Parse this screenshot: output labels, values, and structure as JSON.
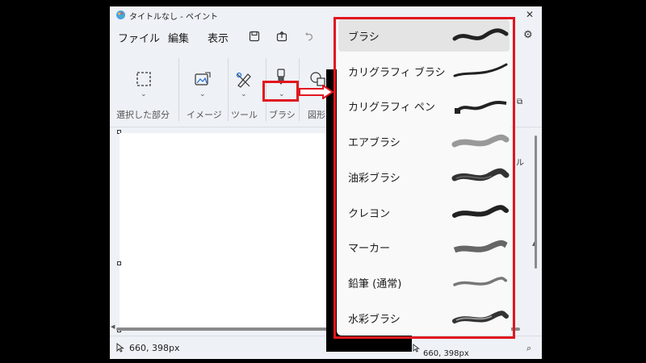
{
  "window": {
    "title": "タイトルなし - ペイント"
  },
  "menu": {
    "file": "ファイル",
    "edit": "編集",
    "view": "表示"
  },
  "ribbon": {
    "selection_label": "選択した部分",
    "image_label": "イメージ",
    "tools_label": "ツール",
    "brushes_label": "ブラシ",
    "shapes_label": "図形"
  },
  "status": {
    "cursor_position": "660, 398px",
    "cursor_position_partial": "660, 398px"
  },
  "brush_menu": {
    "items": [
      {
        "label": "ブラシ",
        "selected": true,
        "stroke": "solid"
      },
      {
        "label": "カリグラフィ ブラシ",
        "selected": false,
        "stroke": "calligraphy"
      },
      {
        "label": "カリグラフィ ペン",
        "selected": false,
        "stroke": "calligraphy-pen"
      },
      {
        "label": "エアブラシ",
        "selected": false,
        "stroke": "airbrush"
      },
      {
        "label": "油彩ブラシ",
        "selected": false,
        "stroke": "oil"
      },
      {
        "label": "クレヨン",
        "selected": false,
        "stroke": "crayon"
      },
      {
        "label": "マーカー",
        "selected": false,
        "stroke": "marker"
      },
      {
        "label": "鉛筆 (通常)",
        "selected": false,
        "stroke": "pencil"
      },
      {
        "label": "水彩ブラシ",
        "selected": false,
        "stroke": "watercolor"
      }
    ]
  },
  "colors": {
    "annotation_red": "#e1161f",
    "accent_blue": "#1f6fd6"
  }
}
